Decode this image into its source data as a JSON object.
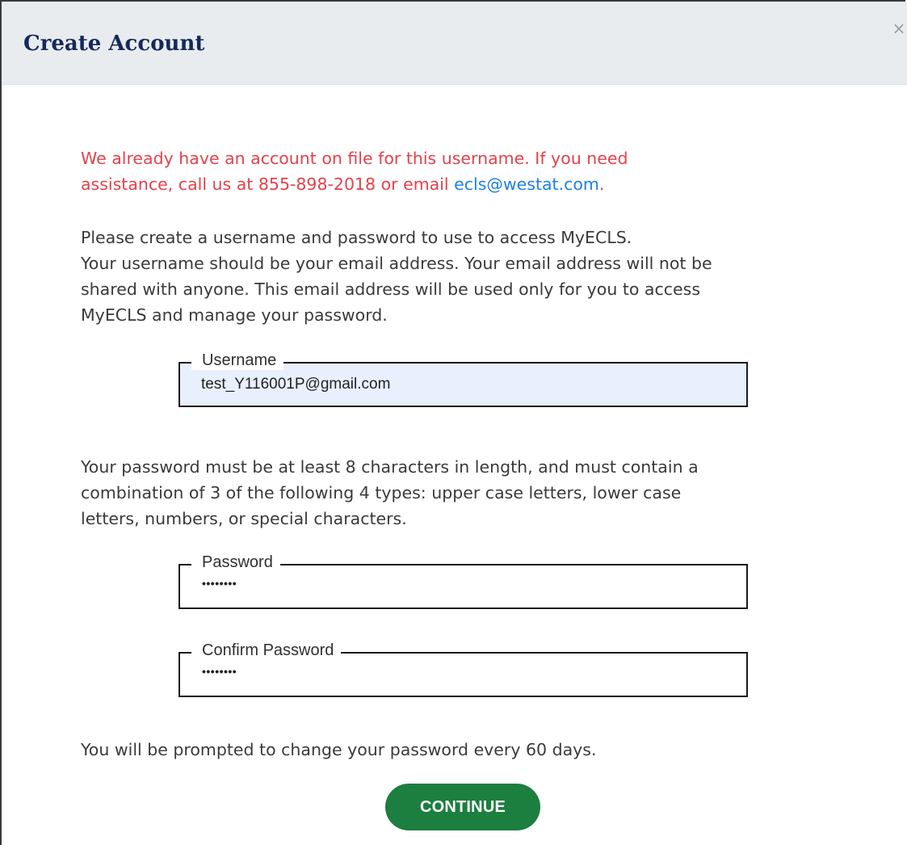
{
  "dialog": {
    "title": "Create Account",
    "close_glyph": "×"
  },
  "error": {
    "line1": "We already have an account on file for this username. If you need",
    "line2_prefix": "assistance, call us at 855-898-2018 or email ",
    "email_link": "ecls@westat.com",
    "line2_suffix": "."
  },
  "intro": {
    "line1": "Please create a username and password to use to access MyECLS.",
    "line2": "Your username should be your email address. Your email address will not be",
    "line3": "shared with anyone. This email address will be used only for you to access",
    "line4": "MyECLS and manage your password."
  },
  "username_field": {
    "label": "Username",
    "value": "test_Y116001P@gmail.com"
  },
  "password_rules": {
    "line1": "Your password must be at least 8 characters in length, and must contain a",
    "line2": "combination of 3 of the following 4 types: upper case letters, lower case",
    "line3": "letters, numbers, or special characters."
  },
  "password_field": {
    "label": "Password",
    "masked_value": "••••••••"
  },
  "confirm_password_field": {
    "label": "Confirm Password",
    "masked_value": "••••••••"
  },
  "reminder": "You will be prompted to change your password every 60 days.",
  "continue_button": {
    "label": "CONTINUE"
  },
  "colors": {
    "header_background": "#e9ecef",
    "title": "#142a5a",
    "error_text": "#e4424b",
    "link": "#1d80e6",
    "body_text": "#3a3a3a",
    "autofill_background": "#e8f0fe",
    "primary_button": "#1c7e3f"
  },
  "icons": {
    "close": "close-icon"
  }
}
